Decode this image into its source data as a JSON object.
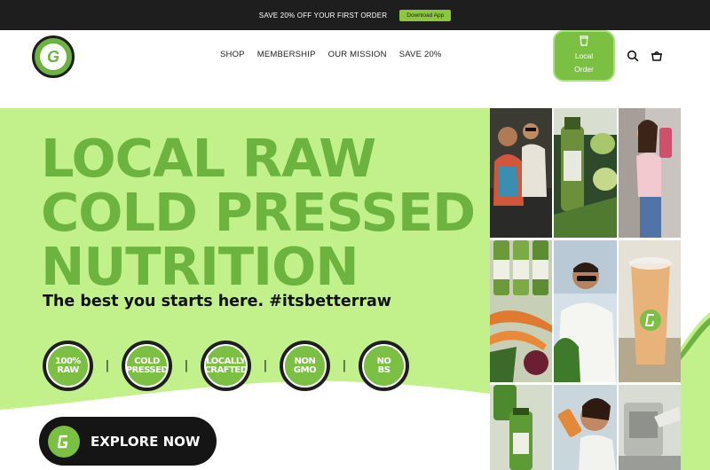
{
  "announcement": {
    "text": "SAVE 20% OFF YOUR FIRST ORDER",
    "button": "Download App"
  },
  "header": {
    "nav": [
      "SHOP",
      "MEMBERSHIP",
      "OUR MISSION",
      "SAVE 20%"
    ],
    "local_order": "Local Order",
    "icons": [
      "search-icon",
      "cart-icon"
    ]
  },
  "hero": {
    "headline": [
      "LOCAL RAW",
      "COLD PRESSED",
      "NUTRITION"
    ],
    "subhead": "The best you starts here. #itsbetterraw",
    "badges": [
      "100%\nRAW",
      "COLD\nPRESSED",
      "LOCALLY\nCRAFTED",
      "NON\nGMO",
      "NO\nBS"
    ],
    "separator": "|",
    "cta": "EXPLORE NOW"
  },
  "colors": {
    "brand_green": "#6db33f",
    "hero_bg": "#c2f08a",
    "dark": "#1e1e1e"
  }
}
